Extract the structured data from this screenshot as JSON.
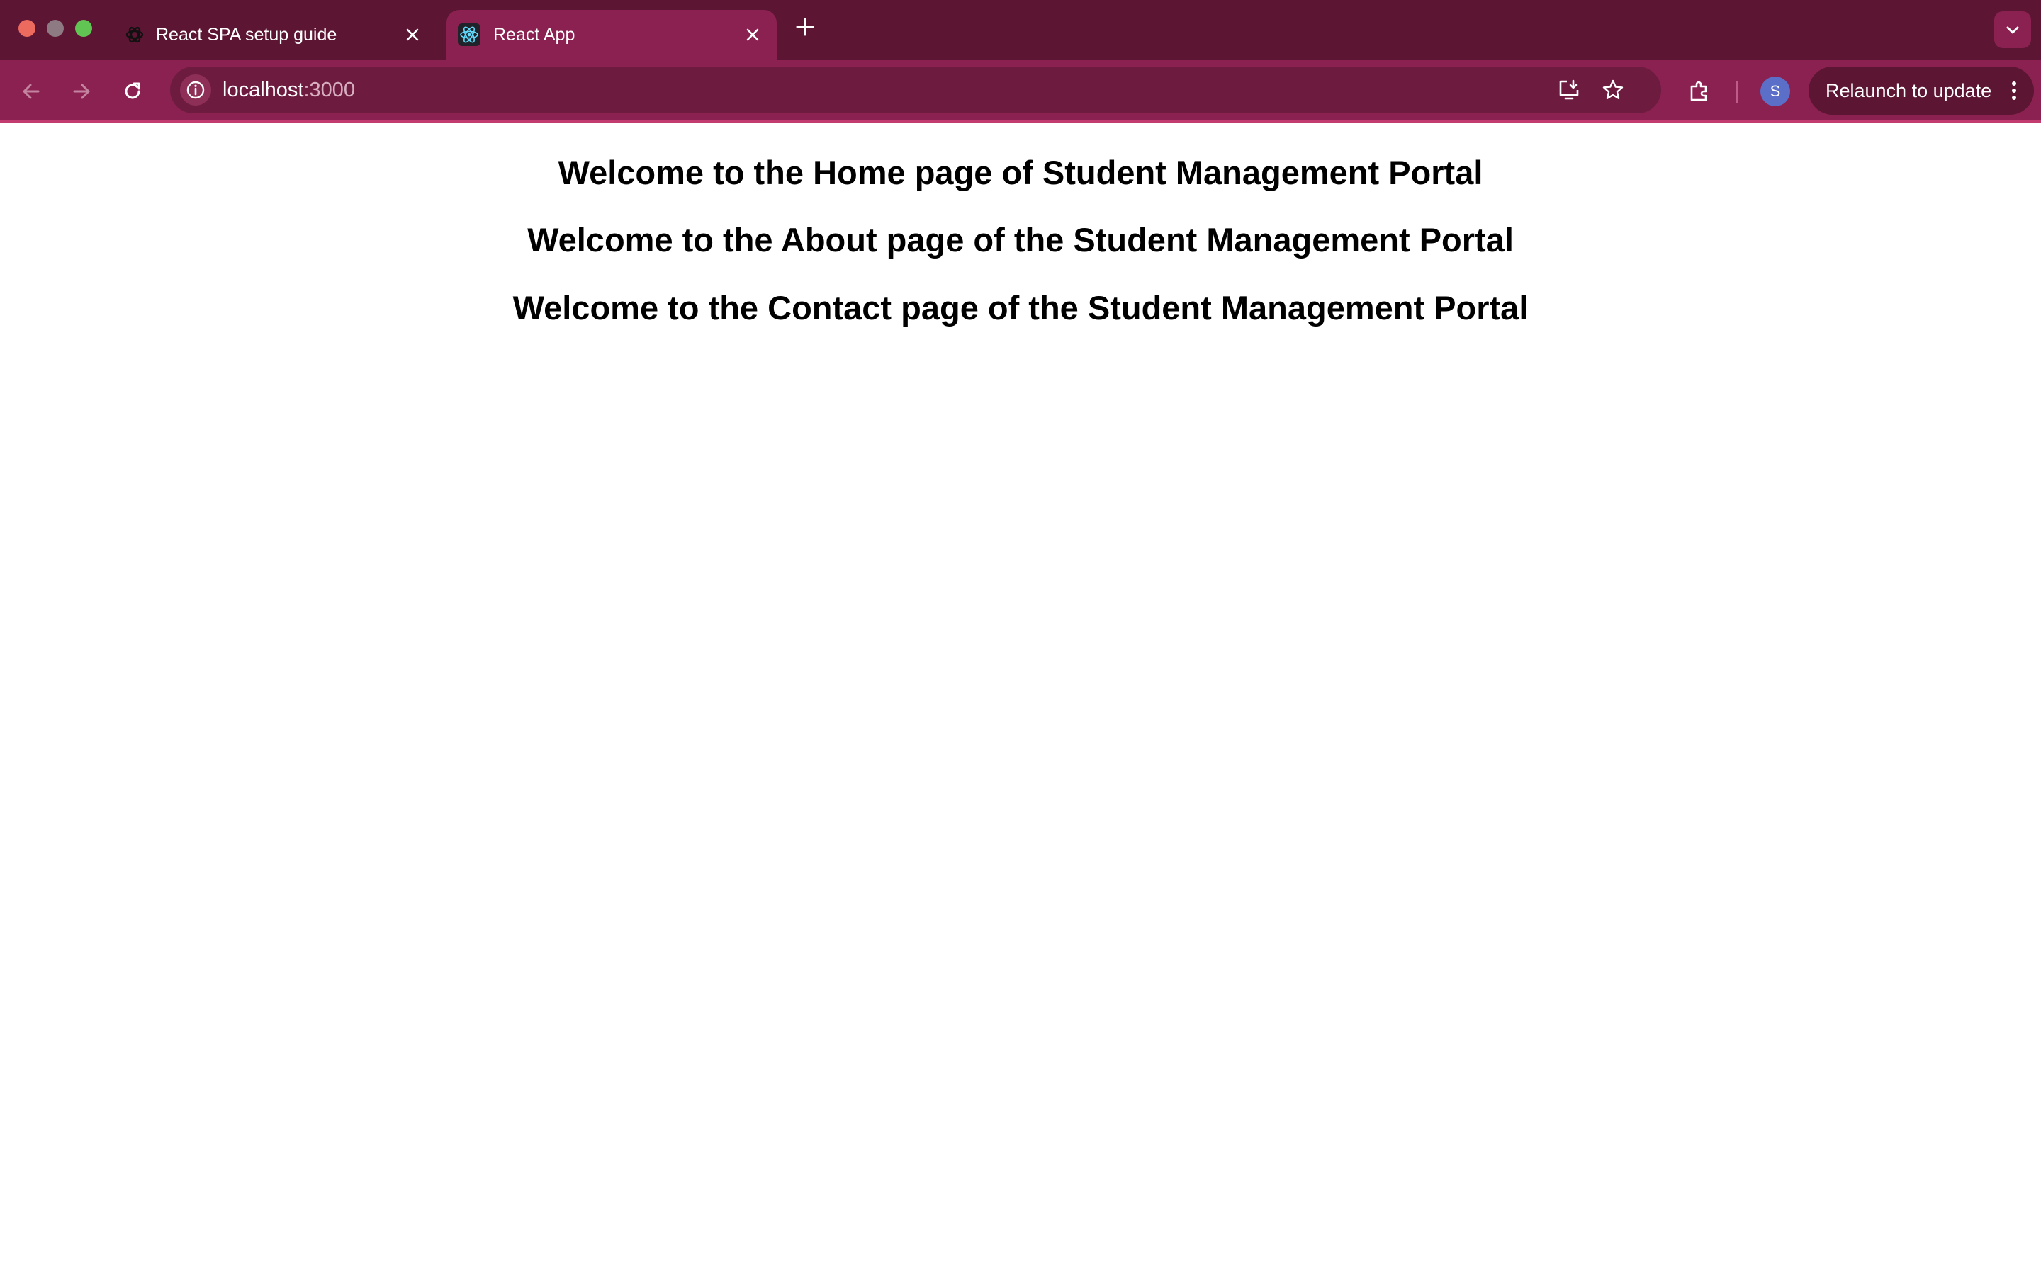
{
  "browser": {
    "tabs": [
      {
        "title": "React SPA setup guide",
        "active": false,
        "favicon": "openai-logo-icon"
      },
      {
        "title": "React App",
        "active": true,
        "favicon": "react-logo-icon"
      }
    ],
    "address_bar": {
      "host": "localhost",
      "port": ":3000"
    },
    "profile_initial": "S",
    "relaunch_label": "Relaunch to update"
  },
  "page": {
    "headings": [
      "Welcome to the Home page of Student Management Portal",
      "Welcome to the About page of the Student Management Portal",
      "Welcome to the Contact page of the Student Management Portal"
    ]
  },
  "colors": {
    "tabstrip_bg": "#5c1532",
    "toolbar_bg": "#8a2150",
    "omnibox_bg": "#6e1b40",
    "avatar_bg": "#5b6fc8"
  }
}
